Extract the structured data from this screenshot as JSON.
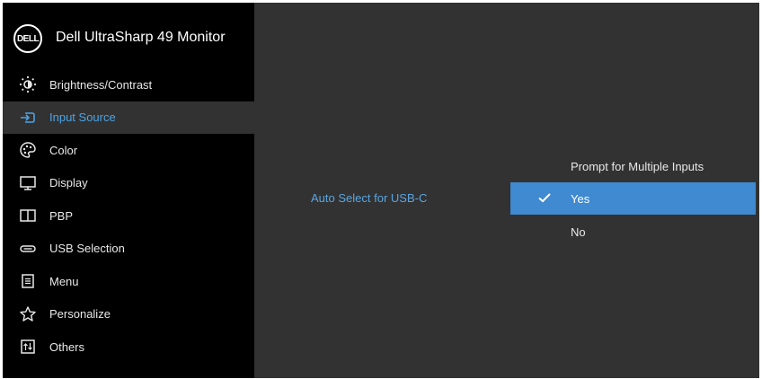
{
  "header": {
    "logo_text": "DELL",
    "title": "Dell UltraSharp 49 Monitor"
  },
  "menu": {
    "items": [
      {
        "label": "Brightness/Contrast",
        "icon": "brightness-icon"
      },
      {
        "label": "Input Source",
        "icon": "input-source-icon",
        "selected": true
      },
      {
        "label": "Color",
        "icon": "color-palette-icon"
      },
      {
        "label": "Display",
        "icon": "display-icon"
      },
      {
        "label": "PBP",
        "icon": "pbp-icon"
      },
      {
        "label": "USB Selection",
        "icon": "usb-icon"
      },
      {
        "label": "Menu",
        "icon": "menu-icon"
      },
      {
        "label": "Personalize",
        "icon": "star-icon"
      },
      {
        "label": "Others",
        "icon": "others-icon"
      }
    ]
  },
  "main": {
    "setting_label": "Auto Select for USB-C",
    "options": [
      {
        "label": "Prompt for Multiple Inputs",
        "selected": false
      },
      {
        "label": "Yes",
        "selected": true
      },
      {
        "label": "No",
        "selected": false
      }
    ]
  },
  "colors": {
    "sidebar_bg": "#000000",
    "panel_bg": "#323232",
    "accent": "#4da3e6",
    "selected_option_bg": "#3f8ad0"
  }
}
